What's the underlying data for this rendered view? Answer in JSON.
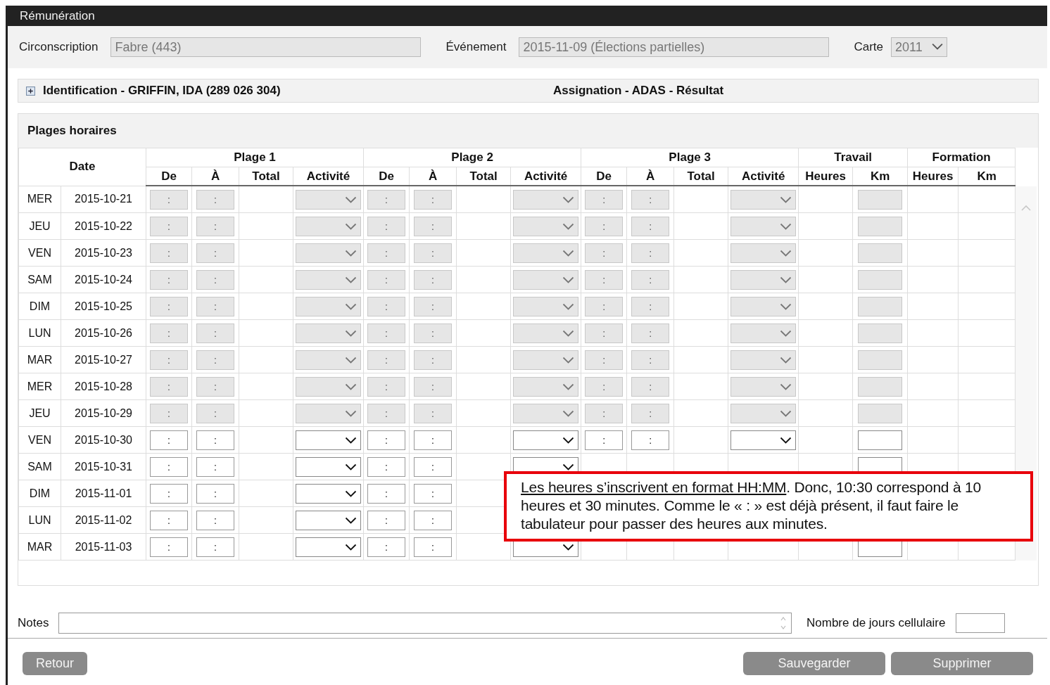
{
  "window": {
    "title": "Rémunération"
  },
  "fields": [
    {
      "label": "Circonscription",
      "value": "Fabre (443)",
      "kind": "text"
    },
    {
      "label": "Événement",
      "value": "2015-11-09 (Élections partielles)",
      "kind": "text"
    },
    {
      "label": "Carte",
      "value": "2011",
      "kind": "select"
    }
  ],
  "identification": {
    "label": "Identification - GRIFFIN, IDA (289 026 304)",
    "expanded": false,
    "assignment": "Assignation - ADAS - Résultat"
  },
  "schedule": {
    "title": "Plages horaires",
    "date_header": "Date",
    "groups": [
      {
        "label": "Plage 1",
        "columns": [
          "De",
          "À",
          "Total",
          "Activité"
        ]
      },
      {
        "label": "Plage 2",
        "columns": [
          "De",
          "À",
          "Total",
          "Activité"
        ]
      },
      {
        "label": "Plage 3",
        "columns": [
          "De",
          "À",
          "Total",
          "Activité"
        ]
      }
    ],
    "totals": [
      {
        "label": "Travail",
        "columns": [
          "Heures",
          "Km"
        ]
      },
      {
        "label": "Formation",
        "columns": [
          "Heures",
          "Km"
        ]
      }
    ],
    "rows": [
      {
        "day": "MER",
        "date": "2015-10-21",
        "disabled": true,
        "slots": [
          {
            "from": ":",
            "to": ":"
          },
          {
            "from": ":",
            "to": ":"
          },
          {
            "from": ":",
            "to": ":"
          }
        ]
      },
      {
        "day": "JEU",
        "date": "2015-10-22",
        "disabled": true,
        "slots": [
          {
            "from": ":",
            "to": ":"
          },
          {
            "from": ":",
            "to": ":"
          },
          {
            "from": ":",
            "to": ":"
          }
        ]
      },
      {
        "day": "VEN",
        "date": "2015-10-23",
        "disabled": true,
        "slots": [
          {
            "from": ":",
            "to": ":"
          },
          {
            "from": ":",
            "to": ":"
          },
          {
            "from": ":",
            "to": ":"
          }
        ]
      },
      {
        "day": "SAM",
        "date": "2015-10-24",
        "disabled": true,
        "slots": [
          {
            "from": ":",
            "to": ":"
          },
          {
            "from": ":",
            "to": ":"
          },
          {
            "from": ":",
            "to": ":"
          }
        ]
      },
      {
        "day": "DIM",
        "date": "2015-10-25",
        "disabled": true,
        "slots": [
          {
            "from": ":",
            "to": ":"
          },
          {
            "from": ":",
            "to": ":"
          },
          {
            "from": ":",
            "to": ":"
          }
        ]
      },
      {
        "day": "LUN",
        "date": "2015-10-26",
        "disabled": true,
        "slots": [
          {
            "from": ":",
            "to": ":"
          },
          {
            "from": ":",
            "to": ":"
          },
          {
            "from": ":",
            "to": ":"
          }
        ]
      },
      {
        "day": "MAR",
        "date": "2015-10-27",
        "disabled": true,
        "slots": [
          {
            "from": ":",
            "to": ":"
          },
          {
            "from": ":",
            "to": ":"
          },
          {
            "from": ":",
            "to": ":"
          }
        ]
      },
      {
        "day": "MER",
        "date": "2015-10-28",
        "disabled": true,
        "slots": [
          {
            "from": ":",
            "to": ":"
          },
          {
            "from": ":",
            "to": ":"
          },
          {
            "from": ":",
            "to": ":"
          }
        ]
      },
      {
        "day": "JEU",
        "date": "2015-10-29",
        "disabled": true,
        "slots": [
          {
            "from": ":",
            "to": ":"
          },
          {
            "from": ":",
            "to": ":"
          },
          {
            "from": ":",
            "to": ":"
          }
        ]
      },
      {
        "day": "VEN",
        "date": "2015-10-30",
        "disabled": false,
        "slots": [
          {
            "from": ":",
            "to": ":"
          },
          {
            "from": ":",
            "to": ":"
          },
          {
            "from": ":",
            "to": ":"
          }
        ]
      },
      {
        "day": "SAM",
        "date": "2015-10-31",
        "disabled": false,
        "slots": [
          {
            "from": ":",
            "to": ":"
          },
          {
            "from": ":",
            "to": ":"
          }
        ]
      },
      {
        "day": "DIM",
        "date": "2015-11-01",
        "disabled": false,
        "slots": [
          {
            "from": ":",
            "to": ":"
          },
          {
            "from": ":",
            "to": ":"
          }
        ]
      },
      {
        "day": "LUN",
        "date": "2015-11-02",
        "disabled": false,
        "slots": [
          {
            "from": ":",
            "to": ":"
          },
          {
            "from": ":",
            "to": ":"
          }
        ]
      },
      {
        "day": "MAR",
        "date": "2015-11-03",
        "disabled": false,
        "slots": [
          {
            "from": ":",
            "to": ":"
          },
          {
            "from": ":",
            "to": ":"
          }
        ]
      }
    ]
  },
  "notes": {
    "label": "Notes"
  },
  "cell_days": {
    "label": "Nombre de jours cellulaire"
  },
  "buttons": [
    {
      "label": "Retour",
      "kind": "back"
    },
    {
      "label": "Sauvegarder",
      "kind": "action"
    },
    {
      "label": "Supprimer",
      "kind": "action"
    }
  ],
  "callout": {
    "underlined": "Les heures s’inscrivent en format HH:MM",
    "text": ". Donc, 10:30 correspond à 10 heures et 30 minutes. Comme le « : » est déjà présent, il faut faire le tabulateur pour passer des heures aux minutes."
  }
}
